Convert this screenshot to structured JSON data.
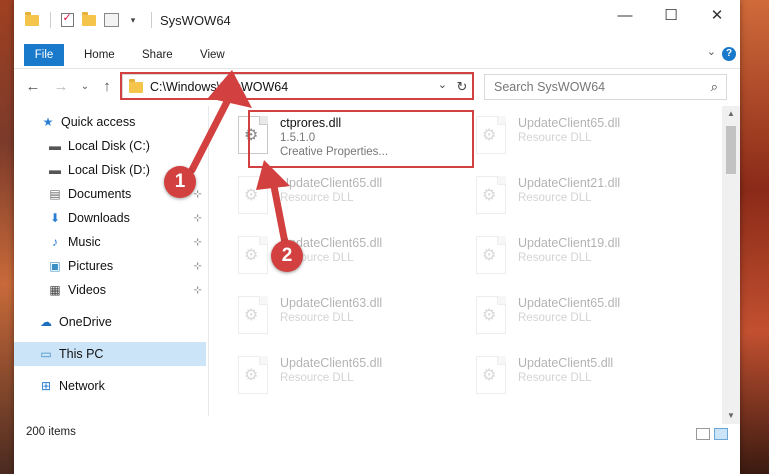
{
  "window": {
    "title": "SysWOW64",
    "minimize": "—",
    "maximize": "☐",
    "close": "✕"
  },
  "ribbon": {
    "tabs": [
      "File",
      "Home",
      "Share",
      "View"
    ],
    "collapse": "⌄",
    "help": "?"
  },
  "nav": {
    "back": "←",
    "forward": "→",
    "recent": "⌄",
    "up": "↑",
    "address": "C:\\Windows\\SysWOW64",
    "dropdown": "⌄",
    "refresh": "↻",
    "search_placeholder": "Search SysWOW64",
    "search_icon": "⌕"
  },
  "sidebar": {
    "items": [
      {
        "label": "Quick access",
        "icon": "star-icon",
        "glyph": "★",
        "color": "#2a7fd4",
        "pinned": false
      },
      {
        "label": "Local Disk (C:)",
        "icon": "drive-icon",
        "glyph": "▬",
        "color": "#555555",
        "pinned": false
      },
      {
        "label": "Local Disk (D:)",
        "icon": "drive-icon",
        "glyph": "▬",
        "color": "#555555",
        "pinned": false
      },
      {
        "label": "Documents",
        "icon": "documents-icon",
        "glyph": "▤",
        "color": "#6b6b6b",
        "pinned": true
      },
      {
        "label": "Downloads",
        "icon": "download-icon",
        "glyph": "⬇",
        "color": "#2a7fd4",
        "pinned": true
      },
      {
        "label": "Music",
        "icon": "music-icon",
        "glyph": "♪",
        "color": "#2a7fd4",
        "pinned": true
      },
      {
        "label": "Pictures",
        "icon": "pictures-icon",
        "glyph": "▣",
        "color": "#3a8fc4",
        "pinned": true
      },
      {
        "label": "Videos",
        "icon": "videos-icon",
        "glyph": "▦",
        "color": "#444444",
        "pinned": true
      },
      {
        "label": "OneDrive",
        "icon": "cloud-icon",
        "glyph": "☁",
        "color": "#1e6fc0",
        "pinned": false
      },
      {
        "label": "This PC",
        "icon": "computer-icon",
        "glyph": "▭",
        "color": "#3a8fc4",
        "pinned": false,
        "selected": true
      },
      {
        "label": "Network",
        "icon": "network-icon",
        "glyph": "⊞",
        "color": "#2a7fd4",
        "pinned": false
      }
    ],
    "pin_glyph": "📌"
  },
  "files": [
    {
      "name": "ctprores.dll",
      "line2": "1.5.1.0",
      "line3": "Creative Properties...",
      "faded": false
    },
    {
      "name": "UpdateClient65.dll",
      "line2": "Resource DLL",
      "faded": true
    },
    {
      "name": "UpdateClient65.dll",
      "line2": "Resource DLL",
      "faded": true
    },
    {
      "name": "UpdateClient21.dll",
      "line2": "Resource DLL",
      "faded": true
    },
    {
      "name": "UpdateClient65.dll",
      "line2": "Resource DLL",
      "faded": true
    },
    {
      "name": "UpdateClient19.dll",
      "line2": "Resource DLL",
      "faded": true
    },
    {
      "name": "UpdateClient63.dll",
      "line2": "Resource DLL",
      "faded": true
    },
    {
      "name": "UpdateClient65.dll",
      "line2": "Resource DLL",
      "faded": true
    },
    {
      "name": "UpdateClient65.dll",
      "line2": "Resource DLL",
      "faded": true
    },
    {
      "name": "UpdateClient5.dll",
      "line2": "Resource DLL",
      "faded": true
    }
  ],
  "status": {
    "count": "200 items"
  },
  "annotations": {
    "step1": "1",
    "step2": "2",
    "color": "#d24040"
  }
}
